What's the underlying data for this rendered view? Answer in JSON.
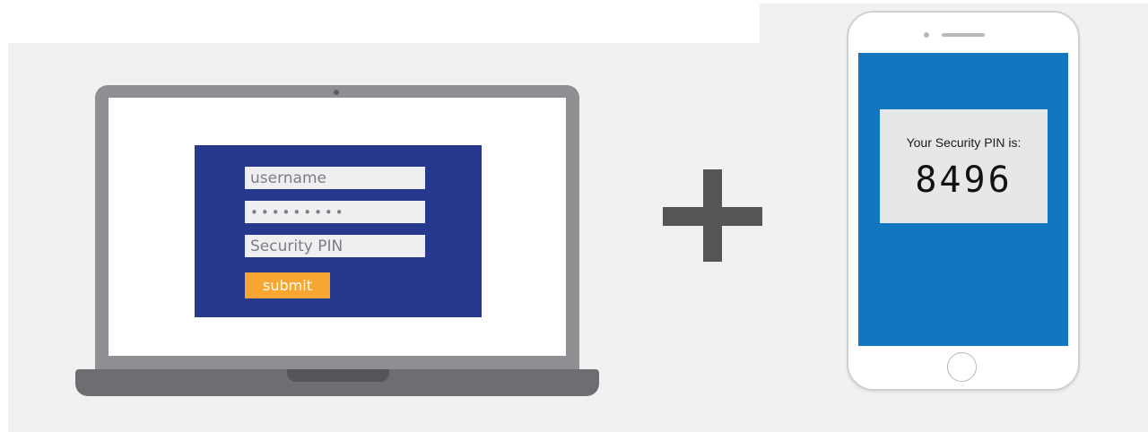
{
  "laptop": {
    "form": {
      "username_placeholder": "username",
      "password_masked": "•••••••••",
      "pin_placeholder": "Security PIN",
      "submit_label": "submit"
    }
  },
  "phone": {
    "pin_label": "Your Security PIN is:",
    "pin_value": "8496"
  },
  "icons": {
    "plus": "plus-icon",
    "laptop": "laptop-icon",
    "phone": "smartphone-icon"
  },
  "colors": {
    "login_panel": "#27388f",
    "submit_button": "#f7a632",
    "phone_screen": "#1377bf",
    "plus_sign": "#555557"
  }
}
